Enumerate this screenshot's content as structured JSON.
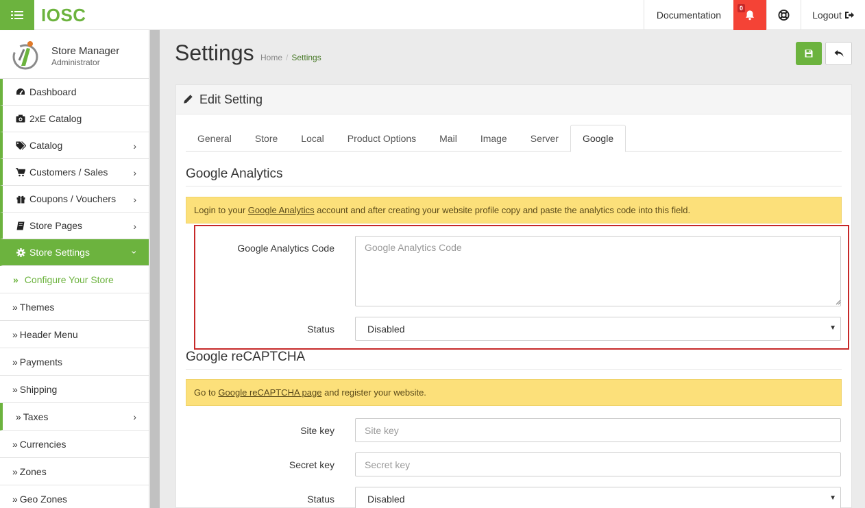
{
  "topbar": {
    "brand": "IOSC",
    "documentation": "Documentation",
    "notifications_count": "0",
    "logout": "Logout"
  },
  "user": {
    "name": "Store Manager",
    "role": "Administrator"
  },
  "sidebar": {
    "items": [
      {
        "label": "Dashboard"
      },
      {
        "label": "2xE Catalog"
      },
      {
        "label": "Catalog"
      },
      {
        "label": "Customers / Sales"
      },
      {
        "label": "Coupons / Vouchers"
      },
      {
        "label": "Store Pages"
      },
      {
        "label": "Store Settings"
      }
    ],
    "sub_items": [
      {
        "label": "Configure Your Store"
      },
      {
        "label": "Themes"
      },
      {
        "label": "Header Menu"
      },
      {
        "label": "Payments"
      },
      {
        "label": "Shipping"
      },
      {
        "label": "Taxes"
      },
      {
        "label": "Currencies"
      },
      {
        "label": "Zones"
      },
      {
        "label": "Geo Zones"
      }
    ]
  },
  "page": {
    "title": "Settings",
    "breadcrumb_home": "Home",
    "breadcrumb_current": "Settings"
  },
  "panel": {
    "heading": "Edit Setting",
    "tabs": [
      "General",
      "Store",
      "Local",
      "Product Options",
      "Mail",
      "Image",
      "Server",
      "Google"
    ],
    "active_tab": "Google"
  },
  "analytics": {
    "title": "Google Analytics",
    "alert_before": "Login to your ",
    "alert_link": "Google Analytics",
    "alert_after": " account and after creating your website profile copy and paste the analytics code into this field.",
    "code_label": "Google Analytics Code",
    "code_placeholder": "Google Analytics Code",
    "status_label": "Status",
    "status_value": "Disabled"
  },
  "recaptcha": {
    "title": "Google reCAPTCHA",
    "alert_before": "Go to ",
    "alert_link": "Google reCAPTCHA page",
    "alert_after": " and register your website.",
    "site_key_label": "Site key",
    "site_key_placeholder": "Site key",
    "secret_key_label": "Secret key",
    "secret_key_placeholder": "Secret key",
    "status_label": "Status",
    "status_value": "Disabled"
  },
  "colors": {
    "brand_green": "#6cb33e",
    "alert_red": "#f44336",
    "warning_yellow": "#fce07a",
    "highlight_red": "#c62828"
  }
}
